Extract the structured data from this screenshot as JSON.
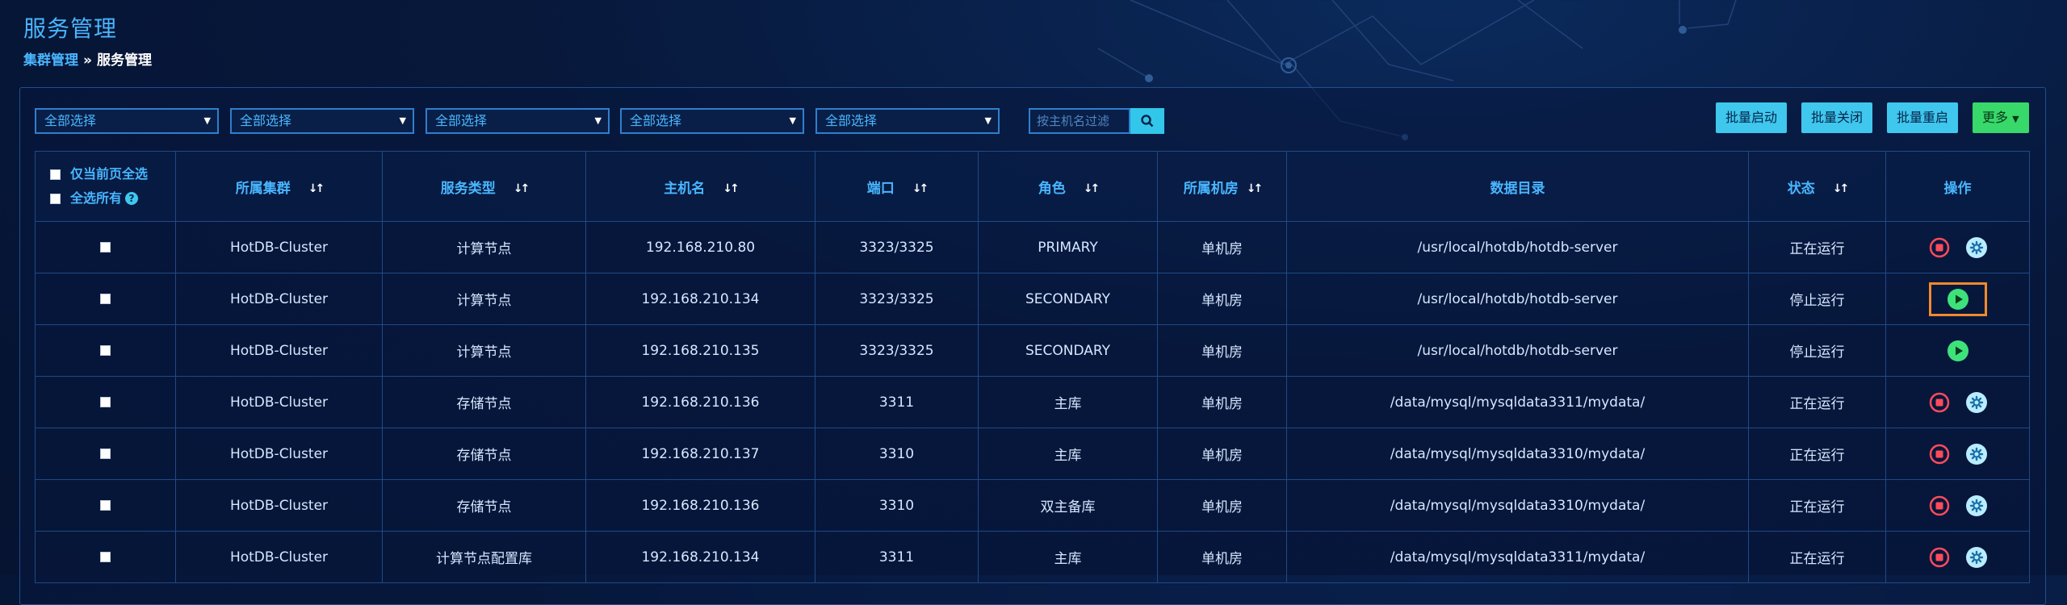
{
  "page": {
    "title": "服务管理"
  },
  "breadcrumb": {
    "parent": "集群管理",
    "separator": "»",
    "current": "服务管理"
  },
  "filters": {
    "selects": [
      "全部选择",
      "全部选择",
      "全部选择",
      "全部选择",
      "全部选择"
    ],
    "search_placeholder": "按主机名过滤"
  },
  "actions": {
    "batch_start": "批量启动",
    "batch_stop": "批量关闭",
    "batch_restart": "批量重启",
    "more": "更多"
  },
  "table": {
    "select_current_page": "仅当前页全选",
    "select_all": "全选所有",
    "help": "?",
    "headers": [
      "所属集群",
      "服务类型",
      "主机名",
      "端口",
      "角色",
      "所属机房",
      "数据目录",
      "状态",
      "操作"
    ],
    "sort_glyph": "↓↑",
    "rows": [
      {
        "cluster": "HotDB-Cluster",
        "type": "计算节点",
        "host": "192.168.210.80",
        "port": "3323/3325",
        "role": "PRIMARY",
        "room": "单机房",
        "dir": "/usr/local/hotdb/hotdb-server",
        "status": "正在运行",
        "state": "running"
      },
      {
        "cluster": "HotDB-Cluster",
        "type": "计算节点",
        "host": "192.168.210.134",
        "port": "3323/3325",
        "role": "SECONDARY",
        "room": "单机房",
        "dir": "/usr/local/hotdb/hotdb-server",
        "status": "停止运行",
        "state": "stopped-highlight"
      },
      {
        "cluster": "HotDB-Cluster",
        "type": "计算节点",
        "host": "192.168.210.135",
        "port": "3323/3325",
        "role": "SECONDARY",
        "room": "单机房",
        "dir": "/usr/local/hotdb/hotdb-server",
        "status": "停止运行",
        "state": "stopped"
      },
      {
        "cluster": "HotDB-Cluster",
        "type": "存储节点",
        "host": "192.168.210.136",
        "port": "3311",
        "role": "主库",
        "room": "单机房",
        "dir": "/data/mysql/mysqldata3311/mydata/",
        "status": "正在运行",
        "state": "running"
      },
      {
        "cluster": "HotDB-Cluster",
        "type": "存储节点",
        "host": "192.168.210.137",
        "port": "3310",
        "role": "主库",
        "room": "单机房",
        "dir": "/data/mysql/mysqldata3310/mydata/",
        "status": "正在运行",
        "state": "running"
      },
      {
        "cluster": "HotDB-Cluster",
        "type": "存储节点",
        "host": "192.168.210.136",
        "port": "3310",
        "role": "双主备库",
        "room": "单机房",
        "dir": "/data/mysql/mysqldata3310/mydata/",
        "status": "正在运行",
        "state": "running"
      },
      {
        "cluster": "HotDB-Cluster",
        "type": "计算节点配置库",
        "host": "192.168.210.134",
        "port": "3311",
        "role": "主库",
        "room": "单机房",
        "dir": "/data/mysql/mysqldata3311/mydata/",
        "status": "正在运行",
        "state": "running"
      }
    ]
  },
  "colors": {
    "accent": "#49b6ff",
    "running": "#3ee27a",
    "stopped": "#ff4b5c",
    "highlight": "#f28a2c"
  }
}
